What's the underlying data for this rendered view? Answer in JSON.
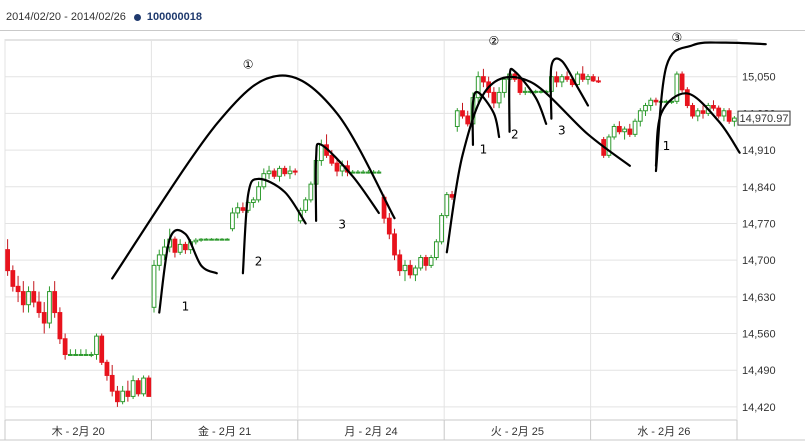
{
  "header": {
    "date_range": "2014/02/20 - 2014/02/26",
    "series_label": "100000018"
  },
  "chart_data": {
    "type": "candlestick",
    "ylim": [
      14395,
      15120
    ],
    "y_ticks": [
      14420,
      14490,
      14560,
      14630,
      14700,
      14770,
      14840,
      14910,
      14980,
      15050
    ],
    "y_tick_labels": [
      "14,420",
      "14,490",
      "14,560",
      "14,630",
      "14,700",
      "14,770",
      "14,840",
      "14,910",
      "14,980",
      "15,050"
    ],
    "last_price": 14970.97,
    "last_price_label": "14,970.97",
    "x_day_labels": [
      "木 - 2月 20",
      "金 - 2月 21",
      "月 - 2月 24",
      "火 - 2月 25",
      "水 - 2月 26"
    ],
    "bars_per_day": 28,
    "candles": [
      [
        14720,
        14740,
        14670,
        14680
      ],
      [
        14680,
        14690,
        14640,
        14650
      ],
      [
        14650,
        14670,
        14620,
        14640
      ],
      [
        14640,
        14660,
        14600,
        14615
      ],
      [
        14615,
        14650,
        14600,
        14640
      ],
      [
        14640,
        14660,
        14610,
        14620
      ],
      [
        14620,
        14640,
        14590,
        14600
      ],
      [
        14600,
        14620,
        14560,
        14580
      ],
      [
        14580,
        14650,
        14570,
        14640
      ],
      [
        14640,
        14660,
        14590,
        14600
      ],
      [
        14600,
        14610,
        14540,
        14550
      ],
      [
        14550,
        14560,
        14510,
        14520
      ],
      [
        14520,
        14530,
        14520,
        14520
      ],
      [
        14520,
        14530,
        14520,
        14520
      ],
      [
        14520,
        14530,
        14520,
        14520
      ],
      [
        14520,
        14530,
        14520,
        14520
      ],
      [
        14520,
        14525,
        14515,
        14520
      ],
      [
        14520,
        14560,
        14510,
        14555
      ],
      [
        14555,
        14560,
        14500,
        14505
      ],
      [
        14505,
        14510,
        14470,
        14480
      ],
      [
        14480,
        14500,
        14440,
        14450
      ],
      [
        14450,
        14460,
        14420,
        14430
      ],
      [
        14430,
        14460,
        14425,
        14450
      ],
      [
        14450,
        14470,
        14430,
        14440
      ],
      [
        14440,
        14480,
        14435,
        14470
      ],
      [
        14470,
        14475,
        14440,
        14445
      ],
      [
        14445,
        14480,
        14440,
        14475
      ],
      [
        14475,
        14480,
        14440,
        14440
      ],
      [
        14610,
        14700,
        14600,
        14690
      ],
      [
        14690,
        14720,
        14680,
        14710
      ],
      [
        14710,
        14740,
        14700,
        14725
      ],
      [
        14725,
        14760,
        14715,
        14740
      ],
      [
        14740,
        14745,
        14705,
        14715
      ],
      [
        14715,
        14740,
        14710,
        14730
      ],
      [
        14730,
        14735,
        14712,
        14720
      ],
      [
        14720,
        14740,
        14712,
        14735
      ],
      [
        14735,
        14742,
        14730,
        14738
      ],
      [
        14738,
        14742,
        14735,
        14740
      ],
      [
        14740,
        14742,
        14738,
        14740
      ],
      [
        14740,
        14742,
        14738,
        14740
      ],
      [
        14740,
        14742,
        14738,
        14740
      ],
      [
        14740,
        14742,
        14738,
        14740
      ],
      [
        14740,
        14742,
        14738,
        14740
      ],
      [
        14760,
        14800,
        14755,
        14790
      ],
      [
        14790,
        14810,
        14780,
        14800
      ],
      [
        14800,
        14810,
        14790,
        14795
      ],
      [
        14795,
        14815,
        14790,
        14810
      ],
      [
        14810,
        14820,
        14800,
        14815
      ],
      [
        14815,
        14850,
        14810,
        14840
      ],
      [
        14840,
        14875,
        14835,
        14865
      ],
      [
        14865,
        14880,
        14855,
        14870
      ],
      [
        14870,
        14875,
        14855,
        14860
      ],
      [
        14860,
        14880,
        14850,
        14875
      ],
      [
        14875,
        14880,
        14860,
        14865
      ],
      [
        14865,
        14880,
        14855,
        14870
      ],
      [
        14870,
        14875,
        14862,
        14868
      ],
      [
        14775,
        14800,
        14770,
        14795
      ],
      [
        14795,
        14820,
        14790,
        14815
      ],
      [
        14815,
        14850,
        14810,
        14845
      ],
      [
        14845,
        14900,
        14840,
        14890
      ],
      [
        14890,
        14930,
        14880,
        14920
      ],
      [
        14920,
        14940,
        14895,
        14900
      ],
      [
        14900,
        14910,
        14880,
        14885
      ],
      [
        14885,
        14895,
        14860,
        14870
      ],
      [
        14870,
        14890,
        14860,
        14880
      ],
      [
        14880,
        14890,
        14860,
        14868
      ],
      [
        14868,
        14872,
        14865,
        14868
      ],
      [
        14868,
        14872,
        14865,
        14868
      ],
      [
        14868,
        14872,
        14865,
        14868
      ],
      [
        14868,
        14872,
        14865,
        14868
      ],
      [
        14868,
        14872,
        14865,
        14868
      ],
      [
        14868,
        14872,
        14865,
        14868
      ],
      [
        14820,
        14825,
        14770,
        14780
      ],
      [
        14780,
        14790,
        14740,
        14750
      ],
      [
        14750,
        14760,
        14700,
        14710
      ],
      [
        14710,
        14720,
        14670,
        14680
      ],
      [
        14680,
        14700,
        14660,
        14690
      ],
      [
        14690,
        14700,
        14665,
        14672
      ],
      [
        14672,
        14690,
        14660,
        14685
      ],
      [
        14685,
        14710,
        14680,
        14705
      ],
      [
        14705,
        14710,
        14680,
        14690
      ],
      [
        14690,
        14710,
        14685,
        14705
      ],
      [
        14705,
        14740,
        14700,
        14735
      ],
      [
        14735,
        14790,
        14730,
        14785
      ],
      [
        14785,
        14830,
        14780,
        14825
      ],
      [
        14825,
        14832,
        14815,
        14820
      ],
      [
        14955,
        14990,
        14945,
        14985
      ],
      [
        14985,
        15000,
        14970,
        14975
      ],
      [
        14975,
        14985,
        14955,
        14960
      ],
      [
        14960,
        15020,
        14955,
        15010
      ],
      [
        15010,
        15060,
        15000,
        15050
      ],
      [
        15050,
        15065,
        15030,
        15040
      ],
      [
        15040,
        15050,
        15010,
        15020
      ],
      [
        15020,
        15030,
        14990,
        15000
      ],
      [
        15000,
        15030,
        14990,
        15020
      ],
      [
        15020,
        15050,
        15010,
        15045
      ],
      [
        15045,
        15060,
        15030,
        15055
      ],
      [
        15055,
        15060,
        15040,
        15045
      ],
      [
        15045,
        15050,
        15015,
        15020
      ],
      [
        15020,
        15030,
        15015,
        15022
      ],
      [
        15022,
        15025,
        15018,
        15022
      ],
      [
        15022,
        15025,
        15018,
        15022
      ],
      [
        15022,
        15025,
        15018,
        15022
      ],
      [
        15022,
        15025,
        15018,
        15022
      ],
      [
        15022,
        15060,
        15018,
        15050
      ],
      [
        15050,
        15060,
        15030,
        15040
      ],
      [
        15040,
        15055,
        15030,
        15050
      ],
      [
        15050,
        15060,
        15040,
        15045
      ],
      [
        15045,
        15050,
        15030,
        15035
      ],
      [
        15035,
        15060,
        15030,
        15055
      ],
      [
        15055,
        15070,
        15040,
        15045
      ],
      [
        15045,
        15055,
        15035,
        15050
      ],
      [
        15050,
        15055,
        15040,
        15042
      ],
      [
        15042,
        15050,
        15038,
        15040
      ],
      [
        14930,
        14935,
        14895,
        14900
      ],
      [
        14900,
        14940,
        14895,
        14935
      ],
      [
        14935,
        14960,
        14930,
        14955
      ],
      [
        14955,
        14965,
        14940,
        14945
      ],
      [
        14945,
        14955,
        14930,
        14950
      ],
      [
        14950,
        14960,
        14935,
        14940
      ],
      [
        14940,
        14970,
        14935,
        14965
      ],
      [
        14965,
        14990,
        14955,
        14985
      ],
      [
        14985,
        15000,
        14975,
        14995
      ],
      [
        14995,
        15010,
        14985,
        15005
      ],
      [
        15005,
        15010,
        14995,
        15002
      ],
      [
        15002,
        15006,
        14998,
        15003
      ],
      [
        15003,
        15006,
        14998,
        15003
      ],
      [
        15003,
        15006,
        14998,
        15003
      ],
      [
        15003,
        15060,
        14998,
        15055
      ],
      [
        15055,
        15060,
        15020,
        15025
      ],
      [
        15025,
        15030,
        14990,
        14995
      ],
      [
        14995,
        15000,
        14970,
        14975
      ],
      [
        14975,
        14990,
        14965,
        14985
      ],
      [
        14985,
        14995,
        14970,
        14980
      ],
      [
        14980,
        15000,
        14975,
        14995
      ],
      [
        14995,
        15005,
        14985,
        14990
      ],
      [
        14990,
        14995,
        14970,
        14975
      ],
      [
        14975,
        14990,
        14965,
        14985
      ],
      [
        14985,
        14990,
        14960,
        14965
      ],
      [
        14965,
        14975,
        14955,
        14971
      ]
    ],
    "annotations": [
      {
        "text": "①",
        "xi": 46.5,
        "y": 15066
      },
      {
        "text": "②",
        "xi": 93.5,
        "y": 15110
      },
      {
        "text": "③",
        "xi": 128.5,
        "y": 15117
      },
      {
        "text": "1",
        "xi": 34.5,
        "y": 14604
      },
      {
        "text": "2",
        "xi": 48.5,
        "y": 14690
      },
      {
        "text": "3",
        "xi": 64.5,
        "y": 14760
      },
      {
        "text": "1",
        "xi": 91.5,
        "y": 14903
      },
      {
        "text": "2",
        "xi": 97.5,
        "y": 14932
      },
      {
        "text": "3",
        "xi": 106.5,
        "y": 14940
      },
      {
        "text": "1",
        "xi": 126.5,
        "y": 14910
      }
    ],
    "arcs": [
      [
        [
          20.5,
          14665
        ],
        [
          40.5,
          14960
        ],
        [
          52.5,
          15052
        ],
        [
          63.5,
          14980
        ],
        [
          74.5,
          14780
        ]
      ],
      [
        [
          29.5,
          14600
        ],
        [
          31.5,
          14740
        ],
        [
          34.5,
          14750
        ],
        [
          37.5,
          14690
        ],
        [
          40.5,
          14675
        ]
      ],
      [
        [
          45.5,
          14675
        ],
        [
          46.5,
          14825
        ],
        [
          48.5,
          14855
        ],
        [
          53.5,
          14830
        ],
        [
          57.5,
          14770
        ]
      ],
      [
        [
          59.5,
          14775
        ],
        [
          59.5,
          14895
        ],
        [
          60.5,
          14920
        ],
        [
          66.5,
          14860
        ],
        [
          71.5,
          14790
        ]
      ],
      [
        [
          84.5,
          14715
        ],
        [
          87.5,
          14900
        ],
        [
          92.5,
          15030
        ],
        [
          100.5,
          15040
        ],
        [
          111.5,
          14940
        ],
        [
          119.5,
          14880
        ]
      ],
      [
        [
          89.5,
          14920
        ],
        [
          89.5,
          15000
        ],
        [
          90.5,
          15020
        ],
        [
          93.5,
          14980
        ],
        [
          94.5,
          14935
        ]
      ],
      [
        [
          96.5,
          14945
        ],
        [
          96.5,
          15050
        ],
        [
          97.5,
          15060
        ],
        [
          101.5,
          15010
        ],
        [
          103.5,
          14960
        ]
      ],
      [
        [
          104.5,
          14970
        ],
        [
          104.5,
          15070
        ],
        [
          106.5,
          15080
        ],
        [
          109.5,
          15030
        ],
        [
          111.5,
          14995
        ]
      ],
      [
        [
          124.5,
          14870
        ],
        [
          126.5,
          15070
        ],
        [
          131.5,
          15110
        ],
        [
          137.5,
          15115
        ],
        [
          145.5,
          15112
        ]
      ],
      [
        [
          124.5,
          14880
        ],
        [
          125.5,
          14980
        ],
        [
          130.5,
          15018
        ],
        [
          136.5,
          14965
        ],
        [
          140.5,
          14905
        ]
      ]
    ]
  }
}
